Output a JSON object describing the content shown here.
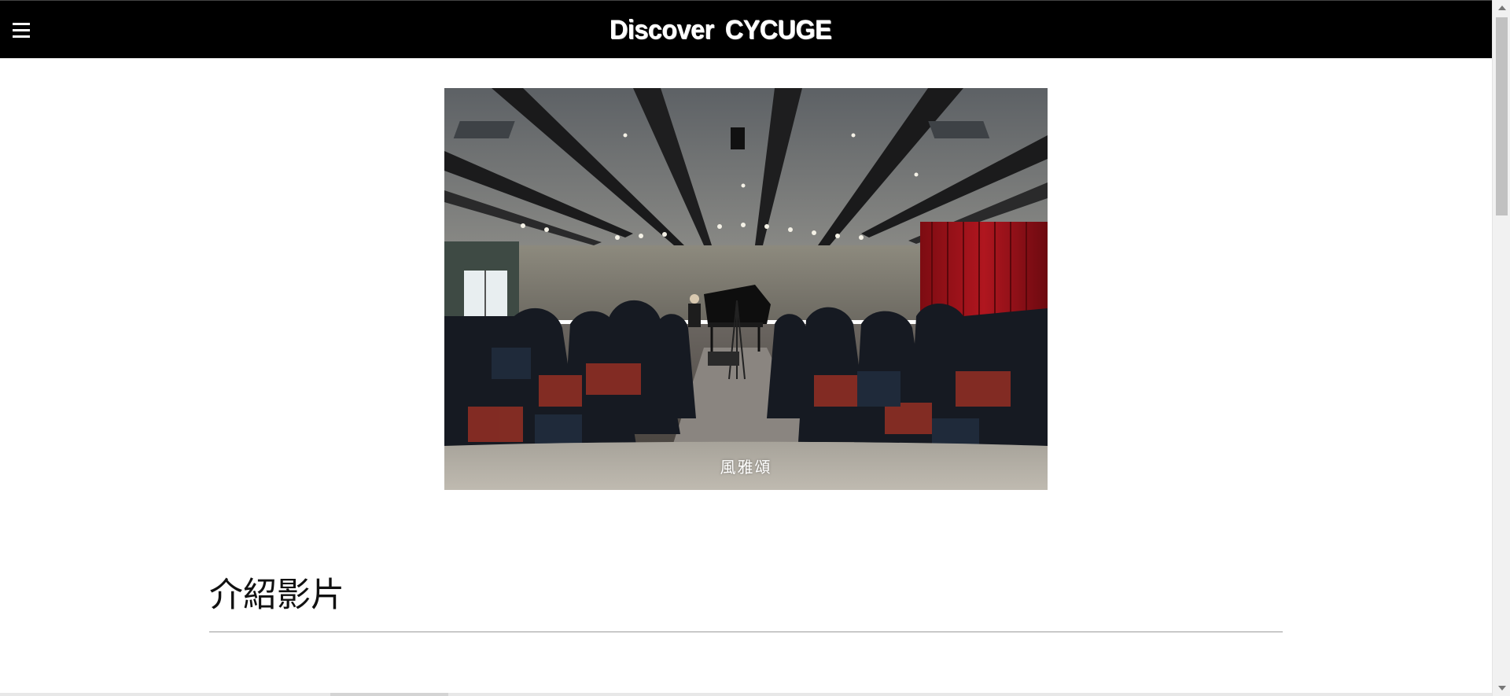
{
  "header": {
    "menu_icon": "hamburger-menu-icon",
    "title": "Discover  CYCUGE",
    "background": "#000000",
    "text_color": "#ffffff"
  },
  "hero": {
    "image_description_icon": "concert-hall-photo",
    "caption": "風雅頌"
  },
  "section": {
    "title": "介紹影片"
  },
  "colors": {
    "curtain": "#9b1119",
    "page_background": "#ffffff"
  }
}
